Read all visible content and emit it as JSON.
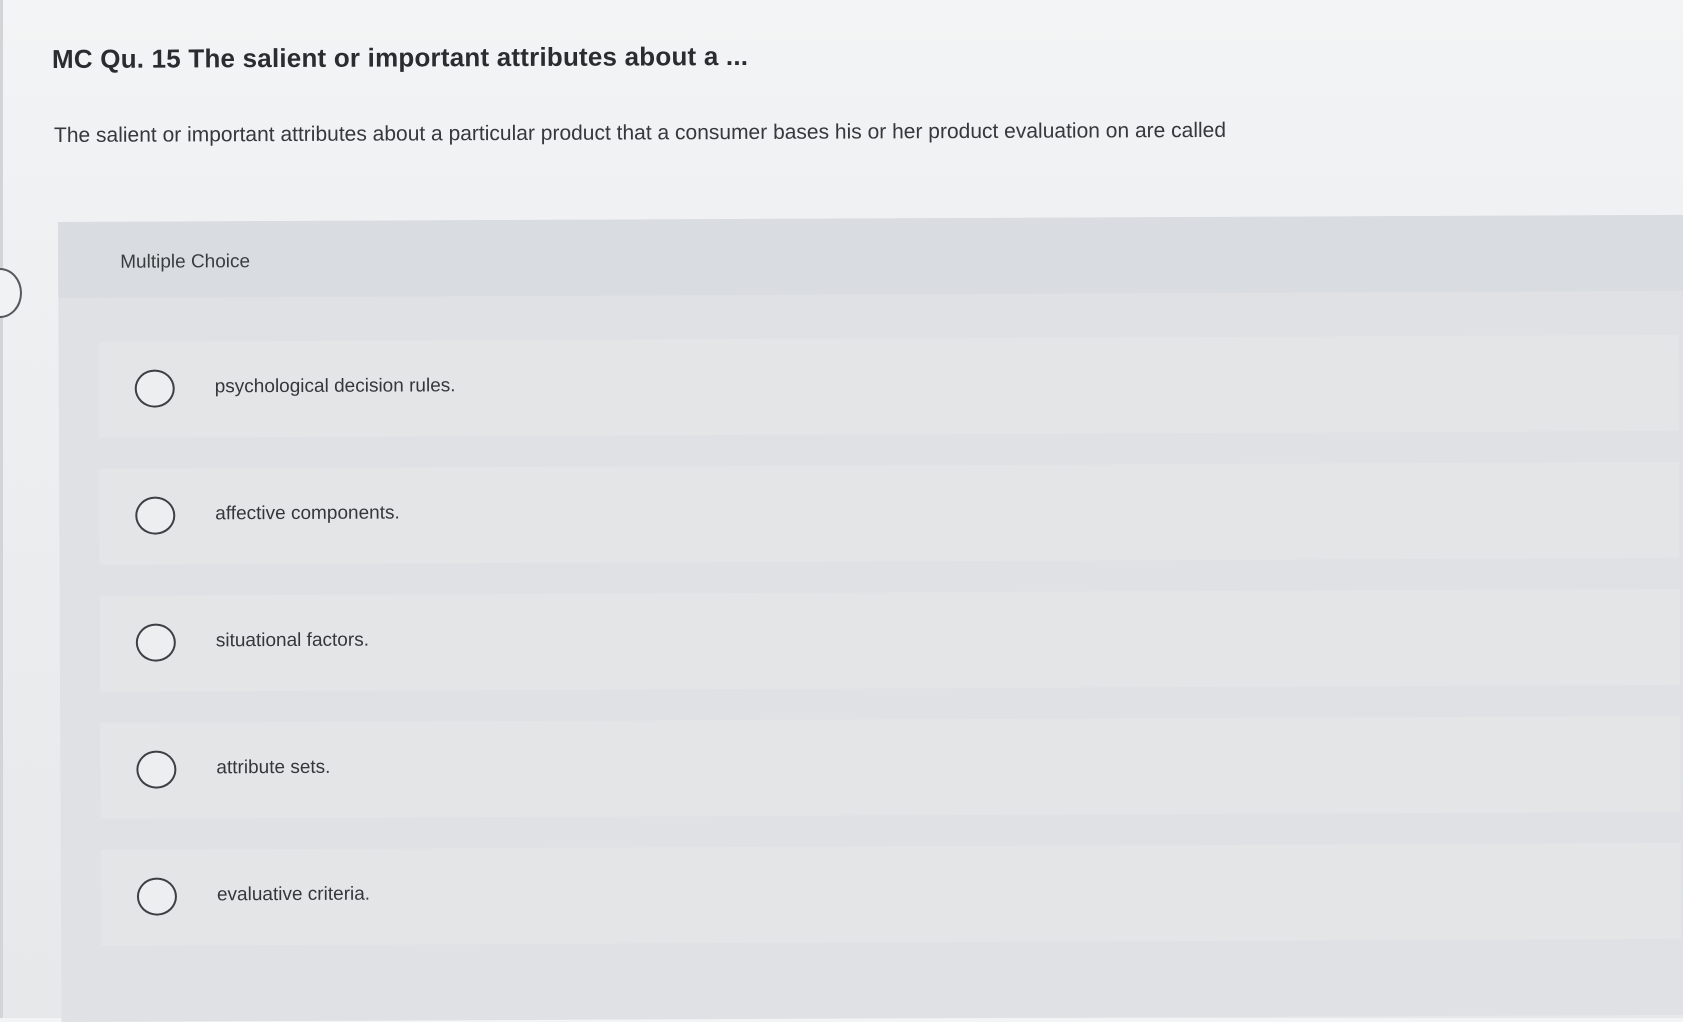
{
  "question": {
    "title": "MC Qu. 15 The salient or important attributes about a ...",
    "text": "The salient or important attributes about a particular product that a consumer bases his or her product evaluation on are called"
  },
  "multiple_choice": {
    "header_label": "Multiple Choice",
    "options": [
      {
        "label": "psychological decision rules."
      },
      {
        "label": "affective components."
      },
      {
        "label": "situational factors."
      },
      {
        "label": "attribute sets."
      },
      {
        "label": "evaluative criteria."
      }
    ]
  },
  "colors": {
    "background": "#eceef0",
    "panel": "#dfe1e4",
    "option_row": "#e3e5e7",
    "text": "#2f3235"
  },
  "icons": {
    "radio": "radio-unchecked-icon",
    "side_tab": "side-tab-handle-icon"
  }
}
